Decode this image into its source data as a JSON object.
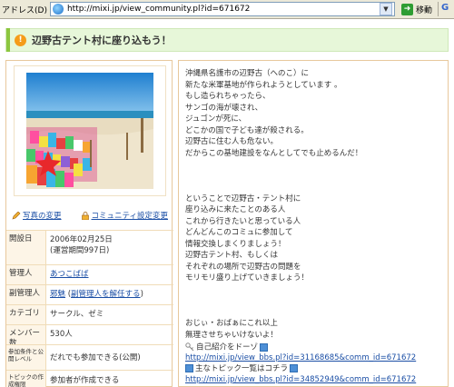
{
  "browser": {
    "address_label": "アドレス(D)",
    "url": "http://mixi.jp/view_community.pl?id=671672",
    "go_label": "移動"
  },
  "page": {
    "title": "辺野古テント村に座り込もう！"
  },
  "sidebar": {
    "photo_change": "写真の変更",
    "community_settings": "コミュニティ設定変更",
    "rows": [
      {
        "label": "開設日",
        "value": "2006年02月25日",
        "value2": "(運営期間997日)"
      },
      {
        "label": "管理人",
        "link": "あつこばば"
      },
      {
        "label": "副管理人",
        "link": "邪魅",
        "mid": " (",
        "link2": "副管理人を解任する",
        "end": ")"
      },
      {
        "label": "カテゴリ",
        "value": "サークル、ゼミ"
      },
      {
        "label": "メンバー数",
        "value": "530人"
      },
      {
        "label": "参加条件と公開レベル",
        "value": "だれでも参加できる(公開)"
      },
      {
        "label": "トピックの作成権限",
        "value": "参加者が作成できる"
      }
    ]
  },
  "description": {
    "lines": [
      "沖縄県名護市の辺野古（へのこ）に",
      "新たな米軍基地が作られようとしています 。",
      "もし造られちゃったら、",
      "サンゴの海が壊され、",
      "ジュゴンが死に、",
      "どこかの国で子ども達が殺される。",
      "辺野古に住む人も危ない。",
      "だからこの基地建設をなんとしてでも止めるんだ！",
      "",
      "",
      "",
      "ということで辺野古・テント村に",
      "座り込みに来たことのある人",
      "これから行きたいと思っている人",
      "どんどんこのコミュに参加して",
      "情報交換しまくりましょう！",
      "辺野古テント村、もしくは",
      "それぞれの場所で辺野古の問題を",
      "モリモリ盛り上げていきましょう！",
      "",
      "",
      "",
      "おじぃ・おばぁにこれ以上",
      "無理させちゃいけないよ！"
    ],
    "intro_label": "自己紹介をドーゾ",
    "intro_url": "http://mixi.jp/view_bbs.pl?id=31168685&comm_id=671672",
    "topics_label": "主なトピック一覧はコチラ",
    "topics_url": "http://mixi.jp/view_bbs.pl?id=34852949&comm_id=671672"
  }
}
